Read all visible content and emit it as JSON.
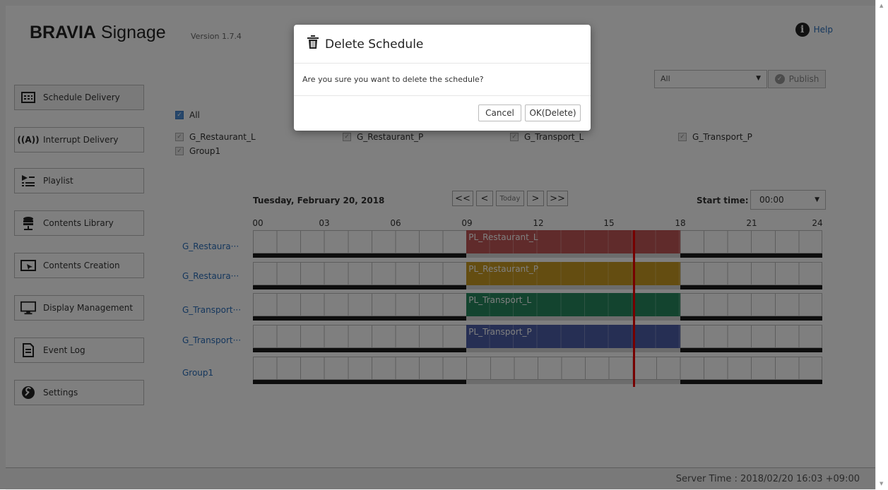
{
  "header": {
    "brand_bold": "BRAVIA",
    "brand_rest": " Signage",
    "version": "Version 1.7.4",
    "help_label": "Help",
    "help_icon": "info-icon"
  },
  "sidebar": {
    "items": [
      {
        "label": "Schedule Delivery",
        "icon": "calendar-icon",
        "active": true
      },
      {
        "label": "Interrupt Delivery",
        "icon": "broadcast-icon"
      },
      {
        "label": "Playlist",
        "icon": "playlist-icon"
      },
      {
        "label": "Contents Library",
        "icon": "library-icon"
      },
      {
        "label": "Contents Creation",
        "icon": "creation-icon"
      },
      {
        "label": "Display Management",
        "icon": "monitor-icon"
      },
      {
        "label": "Event Log",
        "icon": "document-icon"
      },
      {
        "label": "Settings",
        "icon": "wrench-icon"
      }
    ]
  },
  "toolbar": {
    "filter_value": "All",
    "publish_label": "Publish"
  },
  "groups": {
    "all_label": "All",
    "items": [
      "G_Restaurant_L",
      "G_Restaurant_P",
      "G_Transport_L",
      "G_Transport_P",
      "Group1"
    ]
  },
  "schedule": {
    "date": "Tuesday, February 20, 2018",
    "today_label": "Today",
    "prev_fast": "<<",
    "prev": "<",
    "next": ">",
    "next_fast": ">>",
    "start_time_label": "Start time:",
    "start_time_value": "00:00",
    "hours": [
      "00",
      "03",
      "06",
      "09",
      "12",
      "15",
      "18",
      "21",
      "24"
    ],
    "rows": [
      {
        "label": "G_Restaura···",
        "playlist": "PL_Restaurant_L",
        "color": "#c05656",
        "start": 9,
        "end": 18
      },
      {
        "label": "G_Restaura···",
        "playlist": "PL_Restaurant_P",
        "color": "#c89a22",
        "start": 9,
        "end": 18
      },
      {
        "label": "G_Transport···",
        "playlist": "PL_Transport_L",
        "color": "#27885e",
        "start": 9,
        "end": 18
      },
      {
        "label": "G_Transport···",
        "playlist": "PL_Transport_P",
        "color": "#4d5ea8",
        "start": 9,
        "end": 18
      },
      {
        "label": "Group1",
        "playlist": "",
        "color": "",
        "start": null,
        "end": null
      }
    ],
    "now_hour": 16.05
  },
  "footer": {
    "server_time": "Server Time : 2018/02/20 16:03 +09:00"
  },
  "dialog": {
    "title": "Delete Schedule",
    "title_icon": "trash-icon",
    "message": "Are you sure you want to delete the schedule?",
    "cancel_label": "Cancel",
    "ok_label": "OK(Delete)"
  }
}
